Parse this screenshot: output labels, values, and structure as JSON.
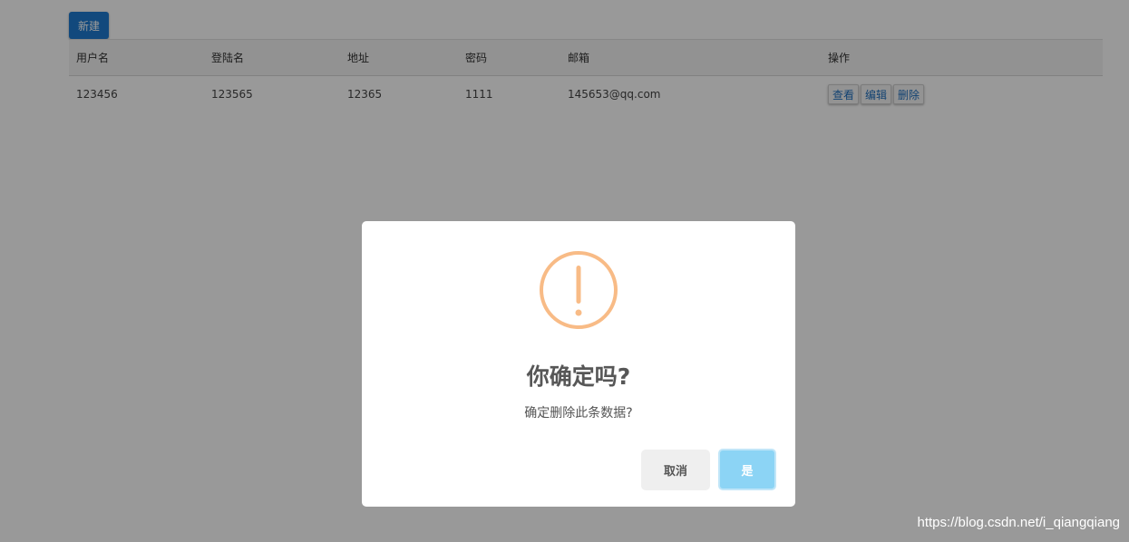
{
  "toolbar": {
    "new_label": "新建"
  },
  "table": {
    "headers": [
      "用户名",
      "登陆名",
      "地址",
      "密码",
      "邮箱",
      "操作"
    ],
    "rows": [
      {
        "username": "123456",
        "login_name": "123565",
        "address": "12365",
        "password": "1111",
        "email": "145653@qq.com",
        "actions": [
          "查看",
          "编辑",
          "删除"
        ]
      }
    ]
  },
  "dialog": {
    "icon": "warning-exclamation-icon",
    "title": "你确定吗?",
    "text": "确定删除此条数据?",
    "cancel_label": "取消",
    "confirm_label": "是"
  },
  "colors": {
    "primary": "#1e7bd0",
    "warning": "#f8bb86",
    "confirm": "#8cd4f5",
    "cancel": "#efefef"
  },
  "watermark": "https://blog.csdn.net/i_qiangqiang"
}
